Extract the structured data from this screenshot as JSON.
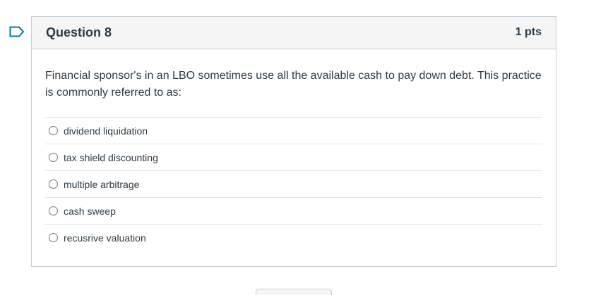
{
  "question": {
    "title": "Question 8",
    "points": "1 pts",
    "text": "Financial sponsor's in an LBO sometimes use all the available cash to pay down debt. This practice is commonly referred to as:",
    "answers": [
      {
        "label": "dividend liquidation",
        "selected": false
      },
      {
        "label": "tax shield discounting",
        "selected": false
      },
      {
        "label": "multiple arbitrage",
        "selected": false
      },
      {
        "label": "cash sweep",
        "selected": false
      },
      {
        "label": "recusrive valuation",
        "selected": false
      }
    ]
  },
  "icons": {
    "flag": "flag-question-icon"
  },
  "colors": {
    "accent": "#0374b5",
    "text": "#2d3b45",
    "border": "#c7cdd1",
    "header_bg": "#f5f5f5"
  }
}
